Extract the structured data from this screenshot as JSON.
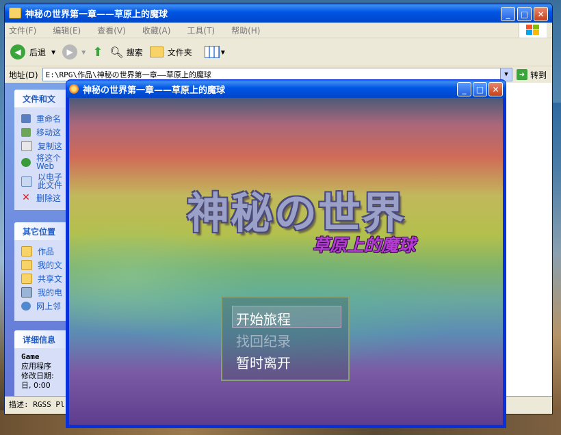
{
  "explorer": {
    "title": "神秘の世界第一章——草原上的魔球",
    "menu": [
      "文件(F)",
      "编辑(E)",
      "查看(V)",
      "收藏(A)",
      "工具(T)",
      "帮助(H)"
    ],
    "toolbar": {
      "back": "后退",
      "search": "搜索",
      "folders": "文件夹"
    },
    "address": {
      "label": "地址(D)",
      "value": "E:\\RPG\\作品\\神秘の世界第一章——草原上的魔球",
      "go": "转到"
    },
    "tasks": {
      "header": "文件和文",
      "items": [
        "重命名",
        "移动这",
        "复制这",
        "将这个\nWeb",
        "以电子\n此文件",
        "删除这"
      ]
    },
    "other": {
      "header": "其它位置",
      "items": [
        "作品",
        "我的文",
        "共享文",
        "我的电",
        "网上邻"
      ]
    },
    "details": {
      "header": "详细信息",
      "name": "Game",
      "type": "应用程序",
      "modified": "修改日期:",
      "time": "日, 0:00"
    },
    "status": "描述: RGSS Pl"
  },
  "game": {
    "title": "神秘の世界第一章——草原上的魔球",
    "title_main": "神秘の世界",
    "title_sub": "草原上的魔球",
    "menu": [
      "开始旅程",
      "找回纪录",
      "暂时离开"
    ]
  },
  "colors": {
    "xp_blue": "#0055e5",
    "panel_text": "#215dc6",
    "sub_title": "#b43cd0"
  }
}
